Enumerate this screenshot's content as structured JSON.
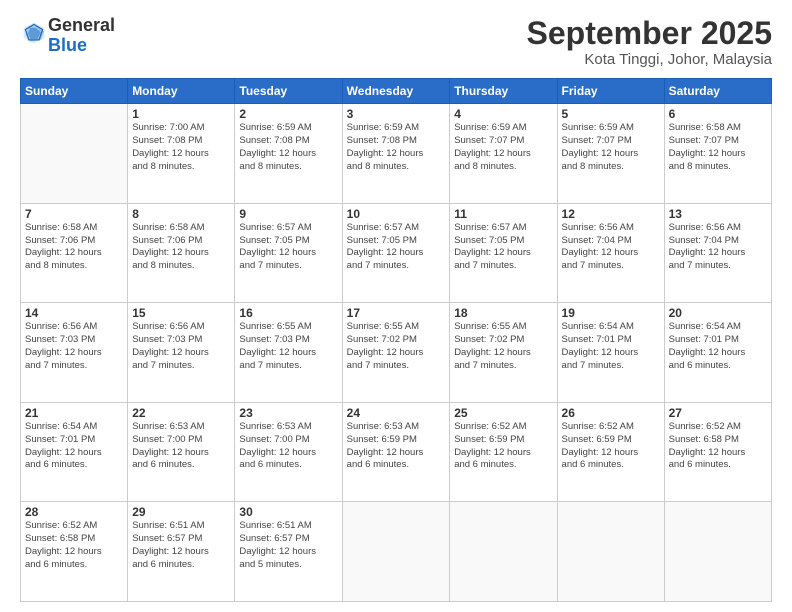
{
  "header": {
    "logo_general": "General",
    "logo_blue": "Blue",
    "month_title": "September 2025",
    "location": "Kota Tinggi, Johor, Malaysia"
  },
  "weekdays": [
    "Sunday",
    "Monday",
    "Tuesday",
    "Wednesday",
    "Thursday",
    "Friday",
    "Saturday"
  ],
  "weeks": [
    [
      {
        "day": "",
        "info": ""
      },
      {
        "day": "1",
        "info": "Sunrise: 7:00 AM\nSunset: 7:08 PM\nDaylight: 12 hours\nand 8 minutes."
      },
      {
        "day": "2",
        "info": "Sunrise: 6:59 AM\nSunset: 7:08 PM\nDaylight: 12 hours\nand 8 minutes."
      },
      {
        "day": "3",
        "info": "Sunrise: 6:59 AM\nSunset: 7:08 PM\nDaylight: 12 hours\nand 8 minutes."
      },
      {
        "day": "4",
        "info": "Sunrise: 6:59 AM\nSunset: 7:07 PM\nDaylight: 12 hours\nand 8 minutes."
      },
      {
        "day": "5",
        "info": "Sunrise: 6:59 AM\nSunset: 7:07 PM\nDaylight: 12 hours\nand 8 minutes."
      },
      {
        "day": "6",
        "info": "Sunrise: 6:58 AM\nSunset: 7:07 PM\nDaylight: 12 hours\nand 8 minutes."
      }
    ],
    [
      {
        "day": "7",
        "info": "Sunrise: 6:58 AM\nSunset: 7:06 PM\nDaylight: 12 hours\nand 8 minutes."
      },
      {
        "day": "8",
        "info": "Sunrise: 6:58 AM\nSunset: 7:06 PM\nDaylight: 12 hours\nand 8 minutes."
      },
      {
        "day": "9",
        "info": "Sunrise: 6:57 AM\nSunset: 7:05 PM\nDaylight: 12 hours\nand 7 minutes."
      },
      {
        "day": "10",
        "info": "Sunrise: 6:57 AM\nSunset: 7:05 PM\nDaylight: 12 hours\nand 7 minutes."
      },
      {
        "day": "11",
        "info": "Sunrise: 6:57 AM\nSunset: 7:05 PM\nDaylight: 12 hours\nand 7 minutes."
      },
      {
        "day": "12",
        "info": "Sunrise: 6:56 AM\nSunset: 7:04 PM\nDaylight: 12 hours\nand 7 minutes."
      },
      {
        "day": "13",
        "info": "Sunrise: 6:56 AM\nSunset: 7:04 PM\nDaylight: 12 hours\nand 7 minutes."
      }
    ],
    [
      {
        "day": "14",
        "info": "Sunrise: 6:56 AM\nSunset: 7:03 PM\nDaylight: 12 hours\nand 7 minutes."
      },
      {
        "day": "15",
        "info": "Sunrise: 6:56 AM\nSunset: 7:03 PM\nDaylight: 12 hours\nand 7 minutes."
      },
      {
        "day": "16",
        "info": "Sunrise: 6:55 AM\nSunset: 7:03 PM\nDaylight: 12 hours\nand 7 minutes."
      },
      {
        "day": "17",
        "info": "Sunrise: 6:55 AM\nSunset: 7:02 PM\nDaylight: 12 hours\nand 7 minutes."
      },
      {
        "day": "18",
        "info": "Sunrise: 6:55 AM\nSunset: 7:02 PM\nDaylight: 12 hours\nand 7 minutes."
      },
      {
        "day": "19",
        "info": "Sunrise: 6:54 AM\nSunset: 7:01 PM\nDaylight: 12 hours\nand 7 minutes."
      },
      {
        "day": "20",
        "info": "Sunrise: 6:54 AM\nSunset: 7:01 PM\nDaylight: 12 hours\nand 6 minutes."
      }
    ],
    [
      {
        "day": "21",
        "info": "Sunrise: 6:54 AM\nSunset: 7:01 PM\nDaylight: 12 hours\nand 6 minutes."
      },
      {
        "day": "22",
        "info": "Sunrise: 6:53 AM\nSunset: 7:00 PM\nDaylight: 12 hours\nand 6 minutes."
      },
      {
        "day": "23",
        "info": "Sunrise: 6:53 AM\nSunset: 7:00 PM\nDaylight: 12 hours\nand 6 minutes."
      },
      {
        "day": "24",
        "info": "Sunrise: 6:53 AM\nSunset: 6:59 PM\nDaylight: 12 hours\nand 6 minutes."
      },
      {
        "day": "25",
        "info": "Sunrise: 6:52 AM\nSunset: 6:59 PM\nDaylight: 12 hours\nand 6 minutes."
      },
      {
        "day": "26",
        "info": "Sunrise: 6:52 AM\nSunset: 6:59 PM\nDaylight: 12 hours\nand 6 minutes."
      },
      {
        "day": "27",
        "info": "Sunrise: 6:52 AM\nSunset: 6:58 PM\nDaylight: 12 hours\nand 6 minutes."
      }
    ],
    [
      {
        "day": "28",
        "info": "Sunrise: 6:52 AM\nSunset: 6:58 PM\nDaylight: 12 hours\nand 6 minutes."
      },
      {
        "day": "29",
        "info": "Sunrise: 6:51 AM\nSunset: 6:57 PM\nDaylight: 12 hours\nand 6 minutes."
      },
      {
        "day": "30",
        "info": "Sunrise: 6:51 AM\nSunset: 6:57 PM\nDaylight: 12 hours\nand 5 minutes."
      },
      {
        "day": "",
        "info": ""
      },
      {
        "day": "",
        "info": ""
      },
      {
        "day": "",
        "info": ""
      },
      {
        "day": "",
        "info": ""
      }
    ]
  ]
}
